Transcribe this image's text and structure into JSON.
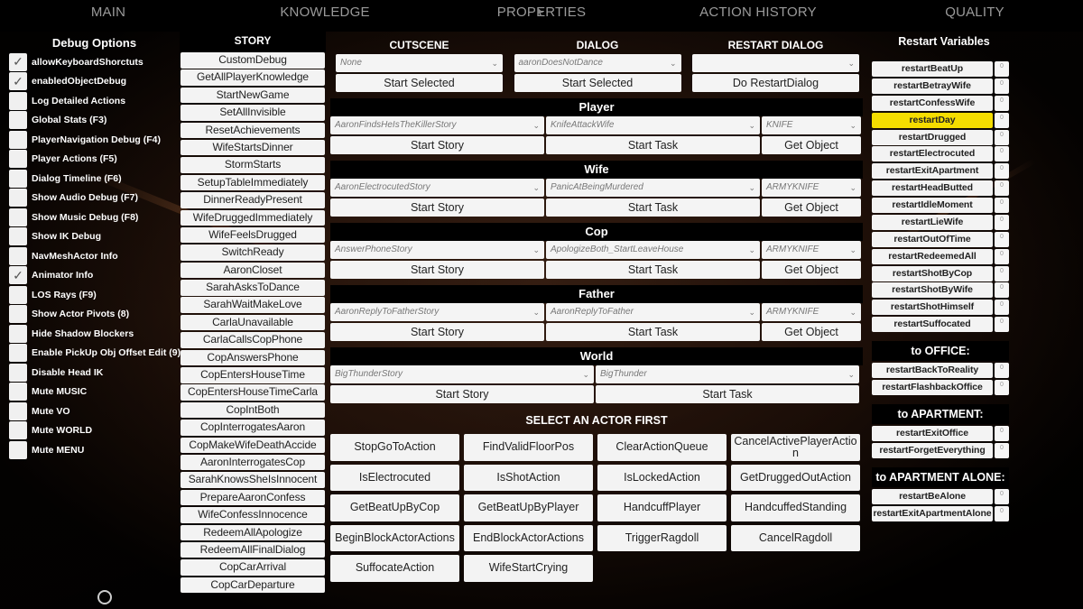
{
  "tabs": [
    "MAIN",
    "KNOWLEDGE",
    "PROPERTIES",
    "ACTION HISTORY",
    "QUALITY"
  ],
  "debug_options": {
    "title": "Debug Options",
    "items": [
      {
        "label": "allowKeyboardShorctuts",
        "checked": true
      },
      {
        "label": "enabledObjectDebug",
        "checked": true
      },
      {
        "label": "Log Detailed Actions",
        "checked": false
      },
      {
        "label": "Global Stats (F3)",
        "checked": false
      },
      {
        "label": "PlayerNavigation Debug (F4)",
        "checked": false
      },
      {
        "label": "Player Actions (F5)",
        "checked": false
      },
      {
        "label": "Dialog Timeline (F6)",
        "checked": false
      },
      {
        "label": "Show Audio Debug (F7)",
        "checked": false
      },
      {
        "label": "Show Music Debug (F8)",
        "checked": false
      },
      {
        "label": "Show IK Debug",
        "checked": false
      },
      {
        "label": "NavMeshActor Info",
        "checked": false
      },
      {
        "label": "Animator Info",
        "checked": true
      },
      {
        "label": "LOS Rays (F9)",
        "checked": false
      },
      {
        "label": "Show Actor Pivots (8)",
        "checked": false
      },
      {
        "label": "Hide Shadow Blockers",
        "checked": false
      },
      {
        "label": "Enable PickUp Obj Offset Edit (9)",
        "checked": false
      },
      {
        "label": "Disable Head IK",
        "checked": false
      },
      {
        "label": "Mute MUSIC",
        "checked": false
      },
      {
        "label": "Mute VO",
        "checked": false
      },
      {
        "label": "Mute WORLD",
        "checked": false
      },
      {
        "label": "Mute MENU",
        "checked": false
      }
    ]
  },
  "story": {
    "title": "STORY",
    "buttons": [
      "CustomDebug",
      "GetAllPlayerKnowledge",
      "StartNewGame",
      "SetAllInvisible",
      "ResetAchievements",
      "WifeStartsDinner",
      "StormStarts",
      "SetupTableImmediately",
      "DinnerReadyPresent",
      "WifeDruggedImmediately",
      "WifeFeelsDrugged",
      "SwitchReady",
      "AaronCloset",
      "SarahAsksToDance",
      "SarahWaitMakeLove",
      "CarlaUnavailable",
      "CarlaCallsCopPhone",
      "CopAnswersPhone",
      "CopEntersHouseTime",
      "CopEntersHouseTimeCarla",
      "CopIntBoth",
      "CopInterrogatesAaron",
      "CopMakeWifeDeathAccide",
      "AaronInterrogatesCop",
      "SarahKnowsSheIsInnocent",
      "PrepareAaronConfess",
      "WifeConfessInnocence",
      "RedeemAllApologize",
      "RedeemAllFinalDialog",
      "CopCarArrival",
      "CopCarDeparture"
    ]
  },
  "cutscene": {
    "title": "CUTSCENE",
    "selected": "None",
    "button": "Start Selected"
  },
  "dialog": {
    "title": "DIALOG",
    "selected": "aaronDoesNotDance",
    "button": "Start Selected"
  },
  "restart_dialog": {
    "title": "RESTART DIALOG",
    "selected": "",
    "button": "Do RestartDialog"
  },
  "actors": [
    {
      "name": "Player",
      "story": "AaronFindsHeIsTheKillerStory",
      "task": "KnifeAttackWife",
      "object": "KNIFE"
    },
    {
      "name": "Wife",
      "story": "AaronElectrocutedStory",
      "task": "PanicAtBeingMurdered",
      "object": "ARMYKNIFE"
    },
    {
      "name": "Cop",
      "story": "AnswerPhoneStory",
      "task": "ApologizeBoth_StartLeaveHouse",
      "object": "ARMYKNIFE"
    },
    {
      "name": "Father",
      "story": "AaronReplyToFatherStory",
      "task": "AaronReplyToFather",
      "object": "ARMYKNIFE"
    }
  ],
  "world": {
    "name": "World",
    "story": "BigThunderStory",
    "task": "BigThunder"
  },
  "actor_buttons": {
    "start_story": "Start Story",
    "start_task": "Start Task",
    "get_object": "Get Object"
  },
  "actions": {
    "title": "SELECT AN ACTOR FIRST",
    "buttons": [
      "StopGoToAction",
      "FindValidFloorPos",
      "ClearActionQueue",
      "CancelActivePlayerAction",
      "IsElectrocuted",
      "IsShotAction",
      "IsLockedAction",
      "GetDruggedOutAction",
      "GetBeatUpByCop",
      "GetBeatUpByPlayer",
      "HandcuffPlayer",
      "HandcuffedStanding",
      "BeginBlockActorActions",
      "EndBlockActorActions",
      "TriggerRagdoll",
      "CancelRagdoll",
      "SuffocateAction",
      "WifeStartCrying"
    ]
  },
  "restart_variables": {
    "title": "Restart Variables",
    "highlight_color": "#f5dd00",
    "items": [
      {
        "label": "restartBeatUp",
        "value": "0",
        "highlighted": false
      },
      {
        "label": "restartBetrayWife",
        "value": "0",
        "highlighted": false
      },
      {
        "label": "restartConfessWife",
        "value": "0",
        "highlighted": false
      },
      {
        "label": "restartDay",
        "value": "0",
        "highlighted": true
      },
      {
        "label": "restartDrugged",
        "value": "0",
        "highlighted": false
      },
      {
        "label": "restartElectrocuted",
        "value": "0",
        "highlighted": false
      },
      {
        "label": "restartExitApartment",
        "value": "0",
        "highlighted": false
      },
      {
        "label": "restartHeadButted",
        "value": "0",
        "highlighted": false
      },
      {
        "label": "restartIdleMoment",
        "value": "0",
        "highlighted": false
      },
      {
        "label": "restartLieWife",
        "value": "0",
        "highlighted": false
      },
      {
        "label": "restartOutOfTime",
        "value": "0",
        "highlighted": false
      },
      {
        "label": "restartRedeemedAll",
        "value": "0",
        "highlighted": false
      },
      {
        "label": "restartShotByCop",
        "value": "0",
        "highlighted": false
      },
      {
        "label": "restartShotByWife",
        "value": "0",
        "highlighted": false
      },
      {
        "label": "restartShotHimself",
        "value": "0",
        "highlighted": false
      },
      {
        "label": "restartSuffocated",
        "value": "0",
        "highlighted": false
      }
    ],
    "groups": [
      {
        "title": "to OFFICE:",
        "items": [
          {
            "label": "restartBackToReality",
            "value": "0"
          },
          {
            "label": "restartFlashbackOffice",
            "value": "0"
          }
        ]
      },
      {
        "title": "to APARTMENT:",
        "items": [
          {
            "label": "restartExitOffice",
            "value": "0"
          },
          {
            "label": "restartForgetEverything",
            "value": "0"
          }
        ]
      },
      {
        "title": "to APARTMENT ALONE:",
        "items": [
          {
            "label": "restartBeAlone",
            "value": "0"
          },
          {
            "label": "restartExitApartmentAlone",
            "value": "0"
          }
        ]
      }
    ]
  },
  "icons": {
    "checkmark": "✓",
    "chevron": "⌄"
  }
}
